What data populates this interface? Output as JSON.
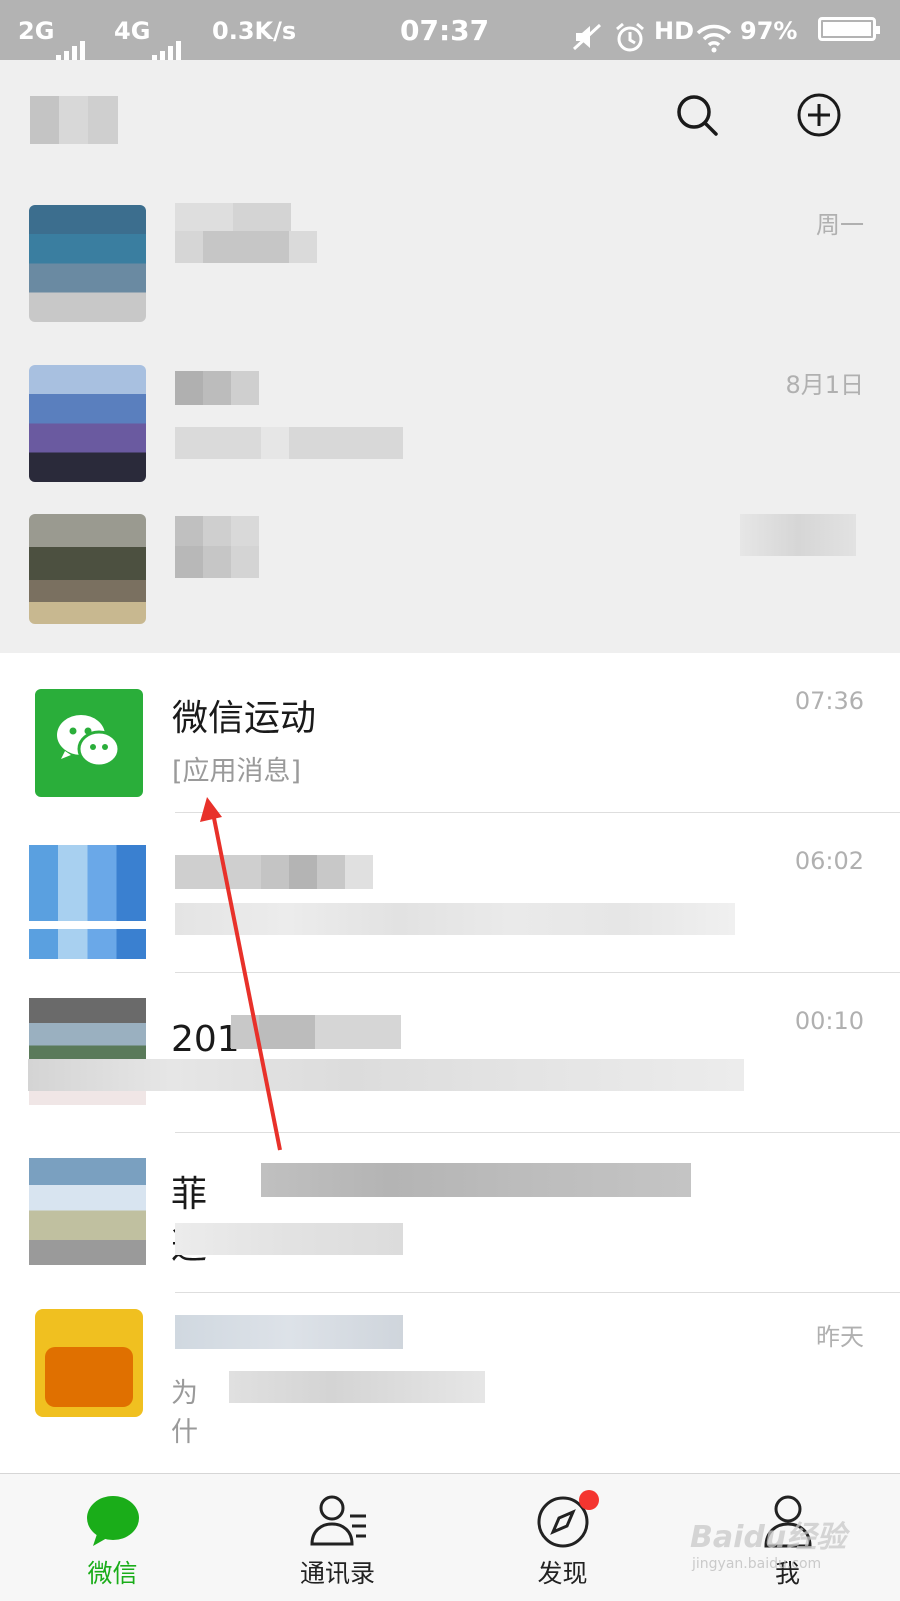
{
  "status_bar": {
    "network1": "2G",
    "network2": "4G",
    "speed": "0.3K/s",
    "time": "07:37",
    "hd": "HD",
    "battery": "97%"
  },
  "chats": [
    {
      "time": "周一"
    },
    {
      "time": "8月1日"
    },
    {
      "time": ""
    },
    {
      "name": "微信运动",
      "preview": "[应用消息]",
      "time": "07:36"
    },
    {
      "time": "06:02"
    },
    {
      "name_partial": "201",
      "time": "00:10"
    },
    {
      "name_partial": "菲迦",
      "time": ""
    },
    {
      "preview_partial": "为什",
      "time": "昨天"
    }
  ],
  "tabs": [
    {
      "label": "微信",
      "icon": "chat-bubble-icon",
      "active": true
    },
    {
      "label": "通讯录",
      "icon": "contacts-icon",
      "active": false
    },
    {
      "label": "发现",
      "icon": "compass-icon",
      "active": false,
      "badge": true
    },
    {
      "label": "我",
      "icon": "profile-icon",
      "active": false
    }
  ],
  "colors": {
    "accent": "#1aad19",
    "badge": "#f43530",
    "annotation_arrow": "#e8312a"
  },
  "watermark": {
    "brand": "Baidu经验",
    "url": "jingyan.baidu.com"
  }
}
